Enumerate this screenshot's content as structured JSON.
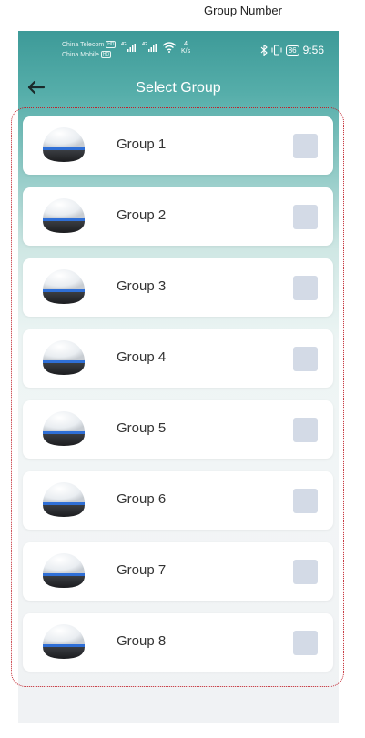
{
  "annotation": {
    "label": "Group Number"
  },
  "status_bar": {
    "carrier_1": "China Telecom",
    "carrier_2": "China Mobile",
    "hd_badge": "HD",
    "network_type": "4G",
    "speed_value": "4",
    "speed_unit": "K/s",
    "battery": "86",
    "time": "9:56"
  },
  "header": {
    "title": "Select Group"
  },
  "groups": [
    {
      "label": "Group 1"
    },
    {
      "label": "Group 2"
    },
    {
      "label": "Group 3"
    },
    {
      "label": "Group 4"
    },
    {
      "label": "Group 5"
    },
    {
      "label": "Group 6"
    },
    {
      "label": "Group 7"
    },
    {
      "label": "Group 8"
    }
  ],
  "icons": {
    "back": "arrow-left-icon",
    "device": "smart-speaker-icon",
    "bluetooth": "bluetooth-icon",
    "vibrate": "vibrate-icon",
    "wifi": "wifi-icon"
  }
}
